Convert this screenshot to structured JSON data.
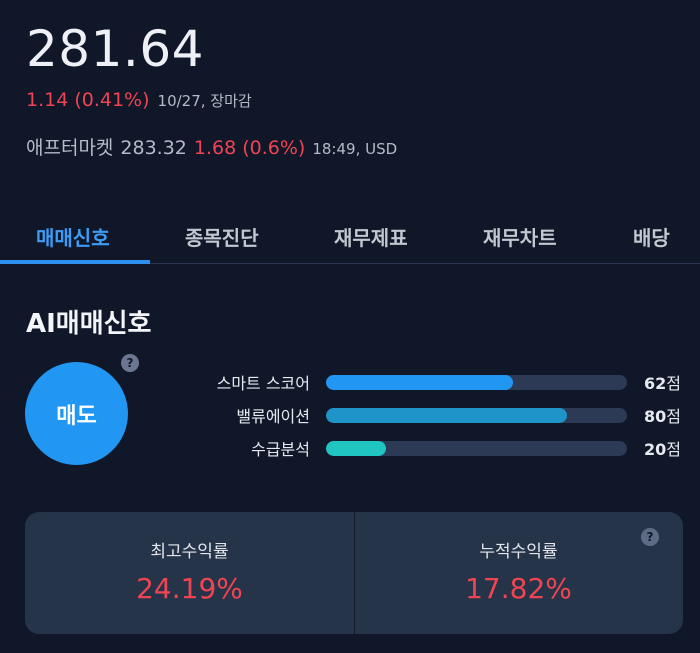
{
  "quote": {
    "price": "281.64",
    "change": "1.14 (0.41%)",
    "meta": "10/27, 장마감",
    "after_market": {
      "label": "애프터마켓",
      "price": "283.32",
      "change": "1.68 (0.6%)",
      "meta": "18:49, USD"
    }
  },
  "tabs": [
    {
      "label": "매매신호",
      "active": true
    },
    {
      "label": "종목진단",
      "active": false
    },
    {
      "label": "재무제표",
      "active": false
    },
    {
      "label": "재무차트",
      "active": false
    },
    {
      "label": "배당",
      "active": false
    }
  ],
  "signal": {
    "title": "AI매매신호",
    "action": "매도",
    "help_icon": "?",
    "metrics": [
      {
        "label": "스마트 스코어",
        "score": 62,
        "score_text": "62",
        "unit": "점",
        "color": "#2196f3"
      },
      {
        "label": "밸류에이션",
        "score": 80,
        "score_text": "80",
        "unit": "점",
        "color": "#1e94c8"
      },
      {
        "label": "수급분석",
        "score": 20,
        "score_text": "20",
        "unit": "점",
        "color": "#20c4c0"
      }
    ]
  },
  "returns": {
    "max": {
      "label": "최고수익률",
      "value": "24.19%"
    },
    "cumulative": {
      "label": "누적수익률",
      "value": "17.82%"
    },
    "help_icon": "?"
  },
  "colors": {
    "background": "#0f1729",
    "accent": "#2f8ff0",
    "down_red": "#f04452",
    "card": "#263449"
  }
}
